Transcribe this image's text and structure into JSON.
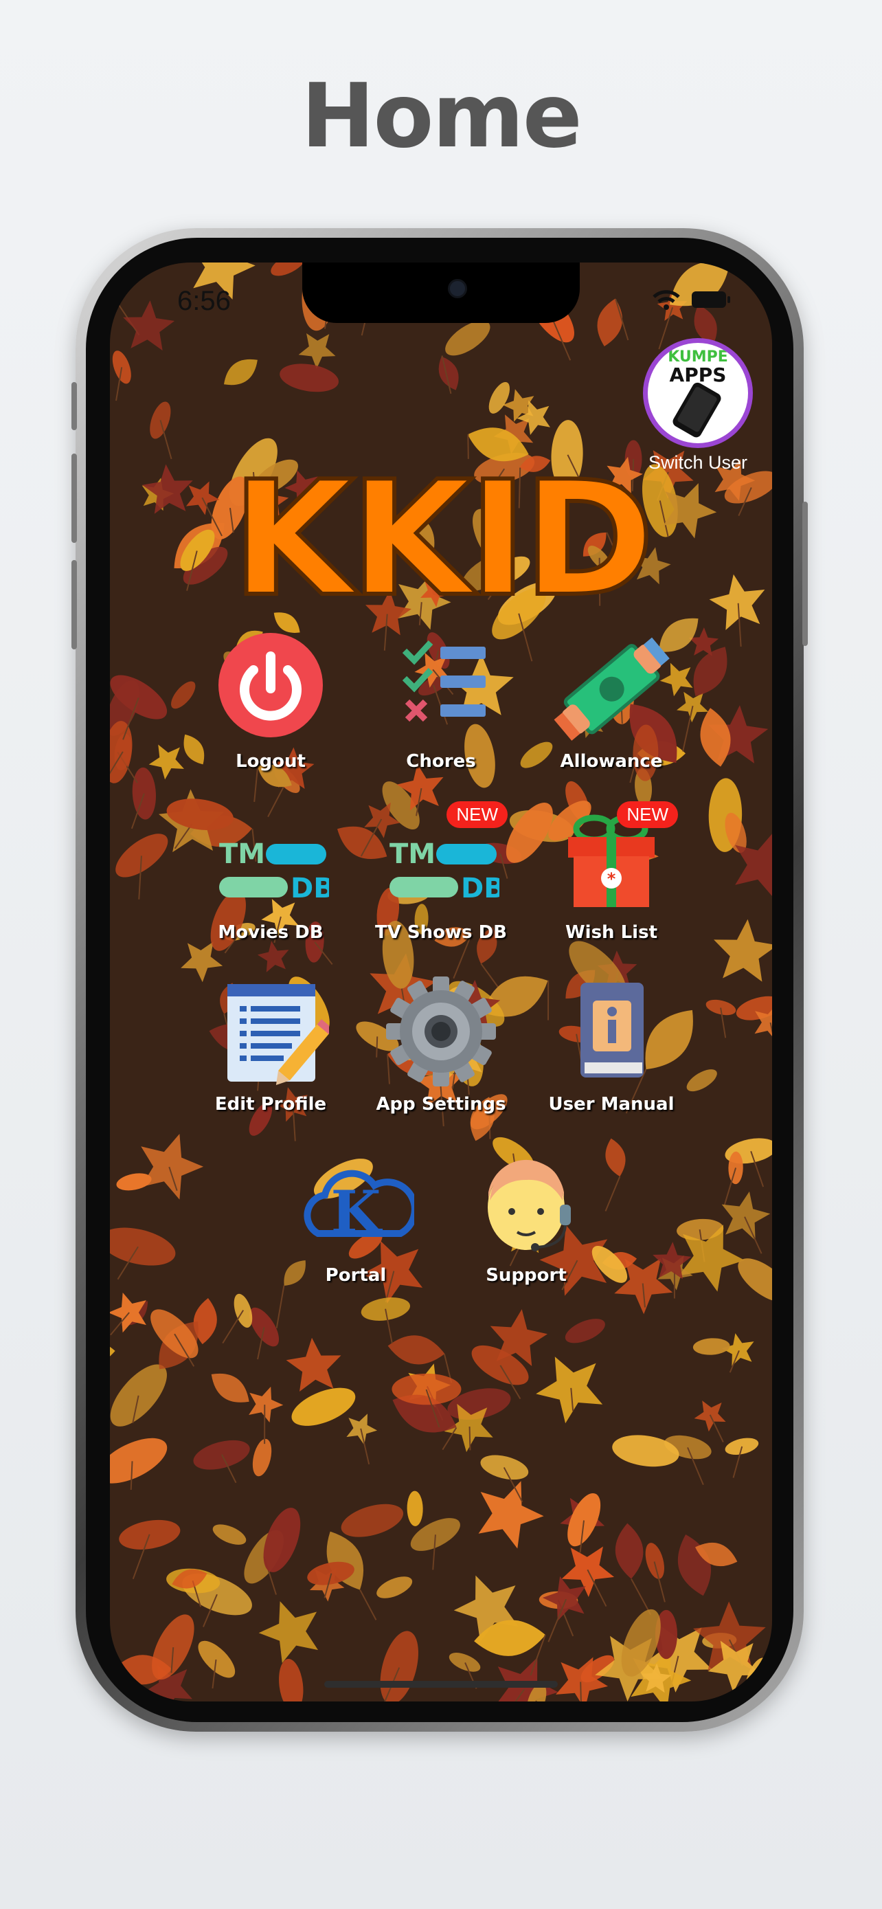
{
  "page": {
    "title": "Home"
  },
  "status_bar": {
    "time": "6:56"
  },
  "switch_user": {
    "logo_line1": "KUMPE",
    "logo_line2": "APPS",
    "label": "Switch User"
  },
  "app": {
    "title": "KKID"
  },
  "tiles": [
    {
      "label": "Logout",
      "icon": "power-icon",
      "badge": ""
    },
    {
      "label": "Chores",
      "icon": "checklist-icon",
      "badge": ""
    },
    {
      "label": "Allowance",
      "icon": "money-icon",
      "badge": ""
    },
    {
      "label": "Movies DB",
      "icon": "tmdb-icon",
      "badge": ""
    },
    {
      "label": "TV Shows DB",
      "icon": "tmdb-icon",
      "badge": "NEW"
    },
    {
      "label": "Wish List",
      "icon": "gift-icon",
      "badge": "NEW"
    },
    {
      "label": "Edit Profile",
      "icon": "edit-document-icon",
      "badge": ""
    },
    {
      "label": "App Settings",
      "icon": "gear-icon",
      "badge": ""
    },
    {
      "label": "User Manual",
      "icon": "manual-book-icon",
      "badge": ""
    },
    {
      "label": "Portal",
      "icon": "cloud-k-icon",
      "badge": ""
    },
    {
      "label": "Support",
      "icon": "support-agent-icon",
      "badge": ""
    }
  ],
  "colors": {
    "title_orange": "#ff7f00",
    "badge_red": "#f5221c",
    "background_brown": "#3a2417",
    "switch_ring": "#9b46d3"
  }
}
